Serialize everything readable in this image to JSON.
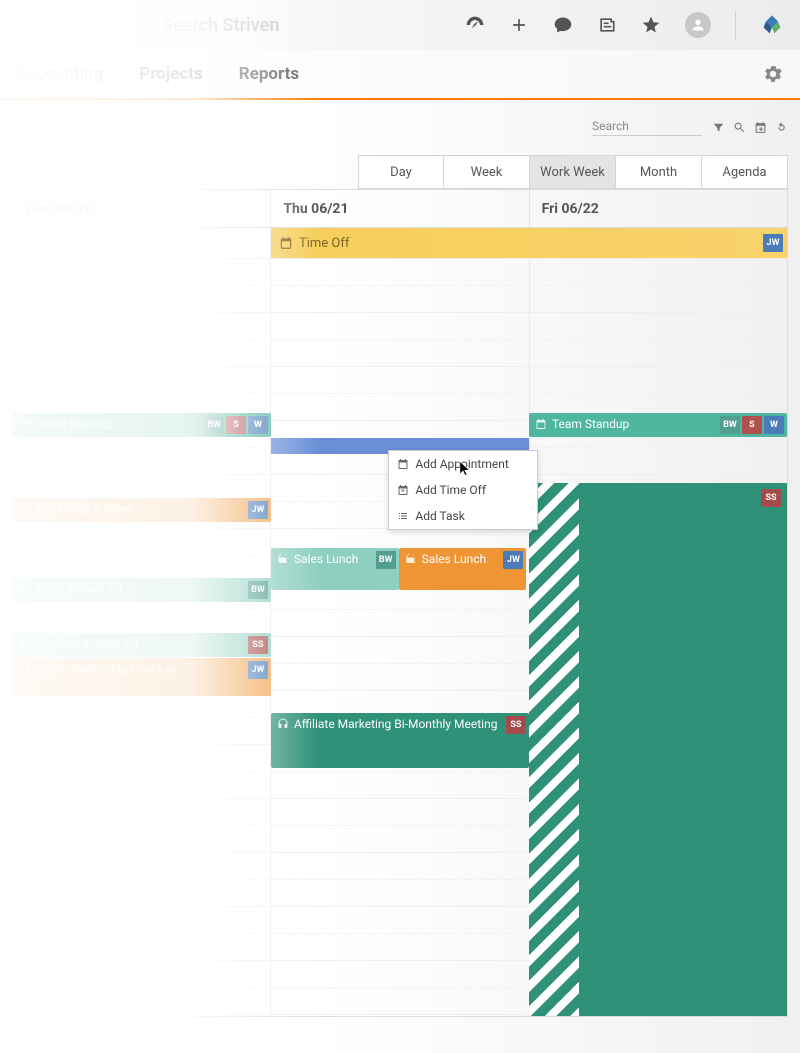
{
  "search_placeholder": "Search Striven",
  "nav": {
    "accounting": "Accounting",
    "projects": "Projects",
    "reports": "Reports"
  },
  "toolbar_search": "Search",
  "view_tabs": {
    "day": "Day",
    "week": "Week",
    "work_week": "Work Week",
    "month": "Month",
    "agenda": "Agenda"
  },
  "columns": {
    "wed": "Wed 06/20",
    "thu": "Thu 06/21",
    "fri": "Fri 06/22"
  },
  "allday": {
    "label": "Time Off",
    "badge": "JW"
  },
  "ctx": {
    "add_appt": "Add Appointment",
    "add_off": "Add Time Off",
    "add_task": "Add Task"
  },
  "events": {
    "team_standup_wed": {
      "label": "Team Standup"
    },
    "team_standup_fri": {
      "label": "Team Standup"
    },
    "mktg": {
      "label": "Marketing & Sales"
    },
    "sales_lunch1": {
      "label": "Sales Lunch"
    },
    "sales_lunch2": {
      "label": "Sales Lunch"
    },
    "brian": {
      "label": "Brian & Joan 1-1"
    },
    "stephen": {
      "label": "Stephen & Joan 1-1"
    },
    "sales_lead": {
      "label": "Sales Leadership Check-in"
    },
    "affiliate": {
      "label": "Affiliate Marketing Bi-Monthly Meeting"
    }
  },
  "badges": {
    "bw": "BW",
    "s": "S",
    "w": "W",
    "jw": "JW",
    "ss": "SS"
  }
}
